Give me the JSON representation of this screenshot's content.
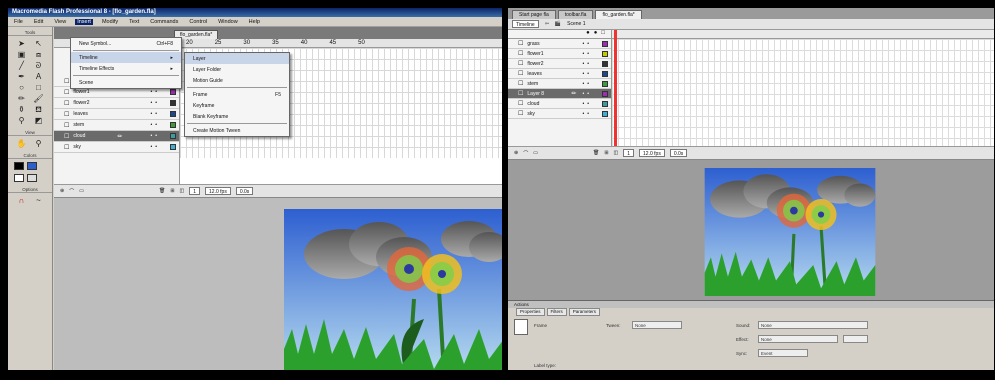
{
  "left": {
    "title": "Macromedia Flash Professional 8 - [flo_garden.fla]",
    "menu": [
      "File",
      "Edit",
      "View",
      "Insert",
      "Modify",
      "Text",
      "Commands",
      "Control",
      "Window",
      "Help"
    ],
    "insert_menu": {
      "new_symbol": "New Symbol...",
      "new_symbol_shortcut": "Ctrl+F8",
      "timeline": "Timeline",
      "timeline_effects": "Timeline Effects",
      "scene": "Scene"
    },
    "timeline_submenu": {
      "layer": "Layer",
      "layer_folder": "Layer Folder",
      "motion_guide": "Motion Guide",
      "frame": "Frame",
      "frame_shortcut": "F5",
      "keyframe": "Keyframe",
      "blank_keyframe": "Blank Keyframe",
      "create_motion_tween": "Create Motion Tween"
    },
    "doc_tab": "flo_garden.fla*",
    "tools_label": "Tools",
    "view_label": "View",
    "colors_label": "Colors",
    "options_label": "Options",
    "ruler": [
      "20",
      "25",
      "30",
      "35",
      "40",
      "45",
      "50"
    ],
    "layers": [
      {
        "name": "grass",
        "color": "#9c2fb0"
      },
      {
        "name": "flower1",
        "color": "#9c2fb0"
      },
      {
        "name": "flower2",
        "color": "#333333"
      },
      {
        "name": "leaves",
        "color": "#1a4a8a"
      },
      {
        "name": "stem",
        "color": "#3c9c3c"
      },
      {
        "name": "cloud",
        "color": "#3c9c9c"
      },
      {
        "name": "sky",
        "color": "#3cb0d0"
      }
    ],
    "footer": {
      "frame": "1",
      "fps": "12.0 fps",
      "time": "0.0s"
    }
  },
  "right": {
    "tabs": [
      "Start page fla",
      "toolbar.fla",
      "flo_garden.fla*"
    ],
    "timeline_label": "Timeline",
    "scene_label": "Scene 1",
    "layers": [
      {
        "name": "grass",
        "color": "#9c2fb0"
      },
      {
        "name": "flower1",
        "color": "#c8c800"
      },
      {
        "name": "flower2",
        "color": "#333333"
      },
      {
        "name": "leaves",
        "color": "#1a4a8a"
      },
      {
        "name": "stem",
        "color": "#3c9c3c"
      },
      {
        "name": "Layer 8",
        "color": "#9c2fb0"
      },
      {
        "name": "cloud",
        "color": "#3c9c9c"
      },
      {
        "name": "sky",
        "color": "#3cb0d0"
      }
    ],
    "footer": {
      "frame": "1",
      "fps": "12.0 fps",
      "time": "0.0s"
    },
    "props": {
      "actions": "Actions",
      "tabs": [
        "Properties",
        "Filters",
        "Parameters"
      ],
      "frame_label": "Frame",
      "tween_label": "Tween:",
      "tween_value": "None",
      "sound_label": "Sound:",
      "sound_value": "None",
      "effect_label": "Effect:",
      "effect_value": "None",
      "sync_label": "Sync:",
      "sync_value": "Event",
      "label_type": "Label type:"
    }
  }
}
